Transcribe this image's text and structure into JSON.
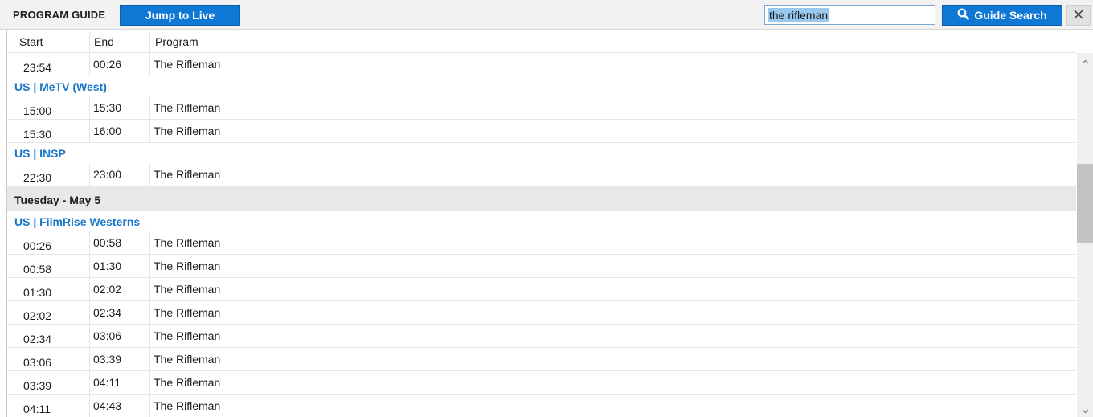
{
  "toolbar": {
    "title": "PROGRAM GUIDE",
    "jump_label": "Jump to Live",
    "search_value": "the rifleman",
    "search_button_label": "Guide Search",
    "search_icon": "search-icon",
    "close_icon": "close-icon",
    "accent_color": "#0f78d4"
  },
  "columns": [
    "Start",
    "End",
    "Program"
  ],
  "rows": [
    {
      "kind": "entry",
      "start": "23:54",
      "end": "00:26",
      "program": "The Rifleman"
    },
    {
      "kind": "channel",
      "label": "US | MeTV (West)"
    },
    {
      "kind": "entry",
      "start": "15:00",
      "end": "15:30",
      "program": "The Rifleman"
    },
    {
      "kind": "entry",
      "start": "15:30",
      "end": "16:00",
      "program": "The Rifleman"
    },
    {
      "kind": "channel",
      "label": "US | INSP"
    },
    {
      "kind": "entry",
      "start": "22:30",
      "end": "23:00",
      "program": "The Rifleman"
    },
    {
      "kind": "day",
      "label": "Tuesday - May 5"
    },
    {
      "kind": "channel",
      "label": "US | FilmRise Westerns"
    },
    {
      "kind": "entry",
      "start": "00:26",
      "end": "00:58",
      "program": "The Rifleman"
    },
    {
      "kind": "entry",
      "start": "00:58",
      "end": "01:30",
      "program": "The Rifleman"
    },
    {
      "kind": "entry",
      "start": "01:30",
      "end": "02:02",
      "program": "The Rifleman"
    },
    {
      "kind": "entry",
      "start": "02:02",
      "end": "02:34",
      "program": "The Rifleman"
    },
    {
      "kind": "entry",
      "start": "02:34",
      "end": "03:06",
      "program": "The Rifleman"
    },
    {
      "kind": "entry",
      "start": "03:06",
      "end": "03:39",
      "program": "The Rifleman"
    },
    {
      "kind": "entry",
      "start": "03:39",
      "end": "04:11",
      "program": "The Rifleman"
    },
    {
      "kind": "entry",
      "start": "04:11",
      "end": "04:43",
      "program": "The Rifleman"
    }
  ],
  "colors": {
    "channel": "#1976c9",
    "day_band": "#e8e8e8"
  }
}
